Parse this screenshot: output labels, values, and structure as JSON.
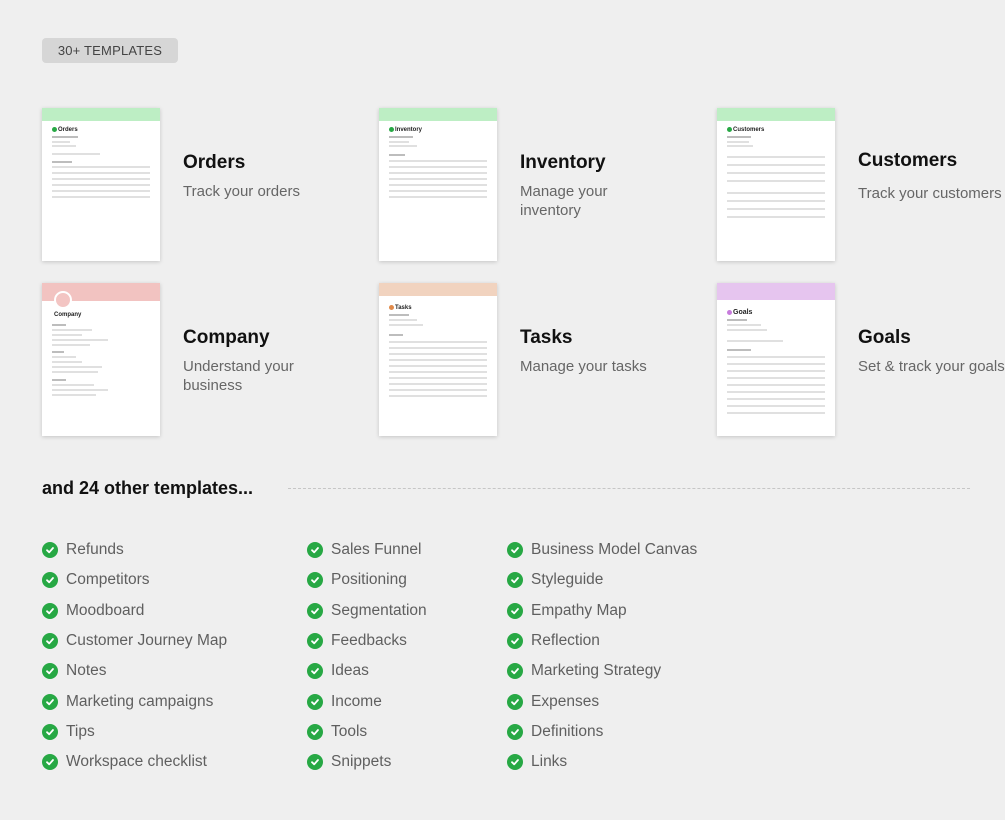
{
  "badge": "30+ TEMPLATES",
  "templates": [
    {
      "name": "Orders",
      "thumb_title": "Orders",
      "desc": "Track your orders",
      "band_color": "#bdeec4"
    },
    {
      "name": "Inventory",
      "thumb_title": "Inventory",
      "desc": "Manage your inventory",
      "band_color": "#bdeec4"
    },
    {
      "name": "Customers",
      "thumb_title": "Customers",
      "desc": "Track your customers",
      "band_color": "#bdeec4"
    },
    {
      "name": "Company",
      "thumb_title": "Company",
      "desc": "Understand your business",
      "band_color": "#f2c3c1"
    },
    {
      "name": "Tasks",
      "thumb_title": "Tasks",
      "desc": "Manage your tasks",
      "band_color": "#f1d3bf"
    },
    {
      "name": "Goals",
      "thumb_title": "Goals",
      "desc": "Set & track your goals",
      "band_color": "#e6c5ef"
    }
  ],
  "other_title": "and 24 other templates...",
  "columns": [
    [
      "Refunds",
      "Competitors",
      "Moodboard",
      "Customer Journey Map",
      "Notes",
      "Marketing campaigns",
      "Tips",
      "Workspace checklist"
    ],
    [
      "Sales Funnel",
      "Positioning",
      "Segmentation",
      "Feedbacks",
      "Ideas",
      "Income",
      "Tools",
      "Snippets"
    ],
    [
      "Business Model Canvas",
      "Styleguide",
      "Empathy Map",
      "Reflection",
      "Marketing Strategy",
      "Expenses",
      "Definitions",
      "Links"
    ]
  ],
  "colors": {
    "check": "#27a844",
    "accent_green": "#bdeec4"
  },
  "icons": {
    "check": "check-circle-icon"
  }
}
